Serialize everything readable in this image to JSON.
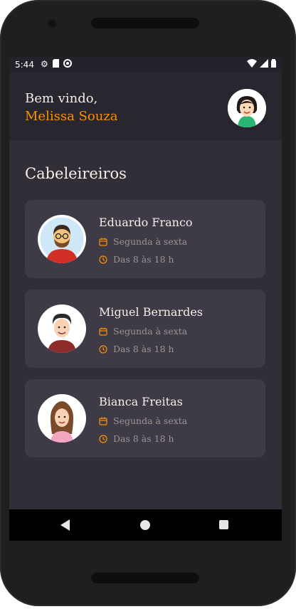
{
  "status_bar": {
    "time": "5:44",
    "left_icons": [
      "gear-icon",
      "sd-card-icon",
      "at-sign-icon"
    ],
    "right_icons": [
      "wifi-icon",
      "signal-icon",
      "battery-icon"
    ]
  },
  "header": {
    "greeting": "Bem vindo,",
    "user_name": "Melissa Souza"
  },
  "main": {
    "section_title": "Cabeleireiros",
    "providers": [
      {
        "name": "Eduardo Franco",
        "days": "Segunda à sexta",
        "hours": "Das 8 às 18 h"
      },
      {
        "name": "Miguel Bernardes",
        "days": "Segunda à sexta",
        "hours": "Das 8 às 18 h"
      },
      {
        "name": "Bianca Freitas",
        "days": "Segunda à sexta",
        "hours": "Das 8 às 18 h"
      }
    ]
  },
  "colors": {
    "background": "#312e38",
    "header_background": "#28262e",
    "card_background": "#3e3b47",
    "accent": "#ff9000",
    "text_primary": "#f4ede8",
    "text_secondary": "#999591"
  },
  "nav_bar": {
    "icons": [
      "back-icon",
      "home-icon",
      "recent-apps-icon"
    ]
  }
}
